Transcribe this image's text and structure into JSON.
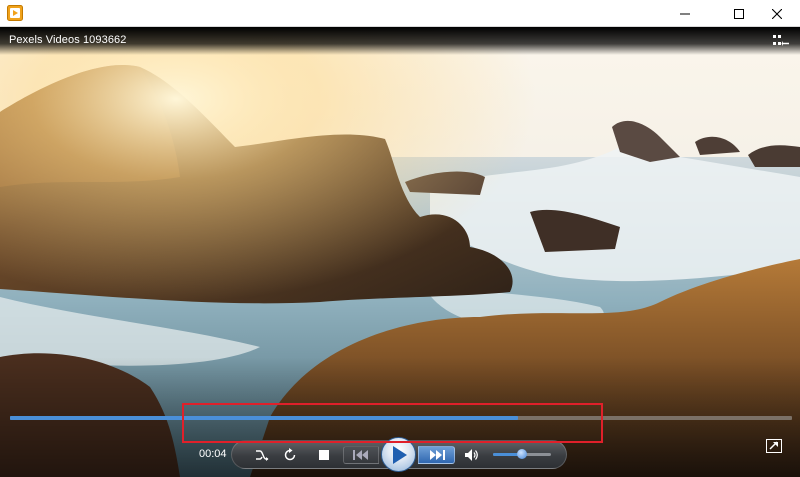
{
  "window": {
    "app_icon": "media-player-icon",
    "controls": [
      "minimize-icon",
      "maximize-icon",
      "close-icon"
    ]
  },
  "video": {
    "title": "Pexels Videos 1093662",
    "progress": 0.65,
    "volume": 0.5
  },
  "controls": {
    "time": "00:04",
    "buttons": [
      "shuffle-icon",
      "repeat-icon",
      "stop-icon",
      "previous-icon",
      "play-icon",
      "next-icon",
      "volume-icon"
    ]
  },
  "overlay": {
    "highlight_color": "#e0202a",
    "accent": "#4a8fd8"
  }
}
